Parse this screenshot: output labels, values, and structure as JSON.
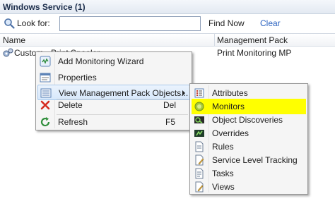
{
  "window": {
    "title": "Windows Service (1)"
  },
  "search": {
    "look_for_label": "Look for:",
    "input_value": "",
    "find_now_label": "Find Now",
    "clear_label": "Clear"
  },
  "columns": {
    "name": "Name",
    "management_pack": "Management Pack"
  },
  "rows": [
    {
      "name": "Custom - Print Spooler",
      "management_pack": "Print Monitoring MP"
    }
  ],
  "context_menu": {
    "items": [
      {
        "label": "Add Monitoring Wizard",
        "shortcut": "",
        "icon": "wizard-icon"
      },
      {
        "label": "Properties",
        "shortcut": "",
        "icon": "properties-icon"
      },
      {
        "label": "View Management Pack Objects...",
        "shortcut": "",
        "icon": "mp-objects-icon",
        "has_submenu": true
      },
      {
        "label": "Delete",
        "shortcut": "Del",
        "icon": "delete-icon"
      },
      {
        "label": "Refresh",
        "shortcut": "F5",
        "icon": "refresh-icon"
      }
    ]
  },
  "submenu": {
    "items": [
      {
        "label": "Attributes",
        "icon": "attributes-icon"
      },
      {
        "label": "Monitors",
        "icon": "monitors-icon",
        "highlighted": true
      },
      {
        "label": "Object Discoveries",
        "icon": "discoveries-icon"
      },
      {
        "label": "Overrides",
        "icon": "overrides-icon"
      },
      {
        "label": "Rules",
        "icon": "rules-icon"
      },
      {
        "label": "Service Level Tracking",
        "icon": "slt-icon"
      },
      {
        "label": "Tasks",
        "icon": "tasks-icon"
      },
      {
        "label": "Views",
        "icon": "views-icon"
      }
    ]
  },
  "colors": {
    "highlight": "#ffff00",
    "link": "#2a62c0",
    "menu_bg": "#f5f5f5",
    "menu_hover": "#d7e8fb"
  }
}
